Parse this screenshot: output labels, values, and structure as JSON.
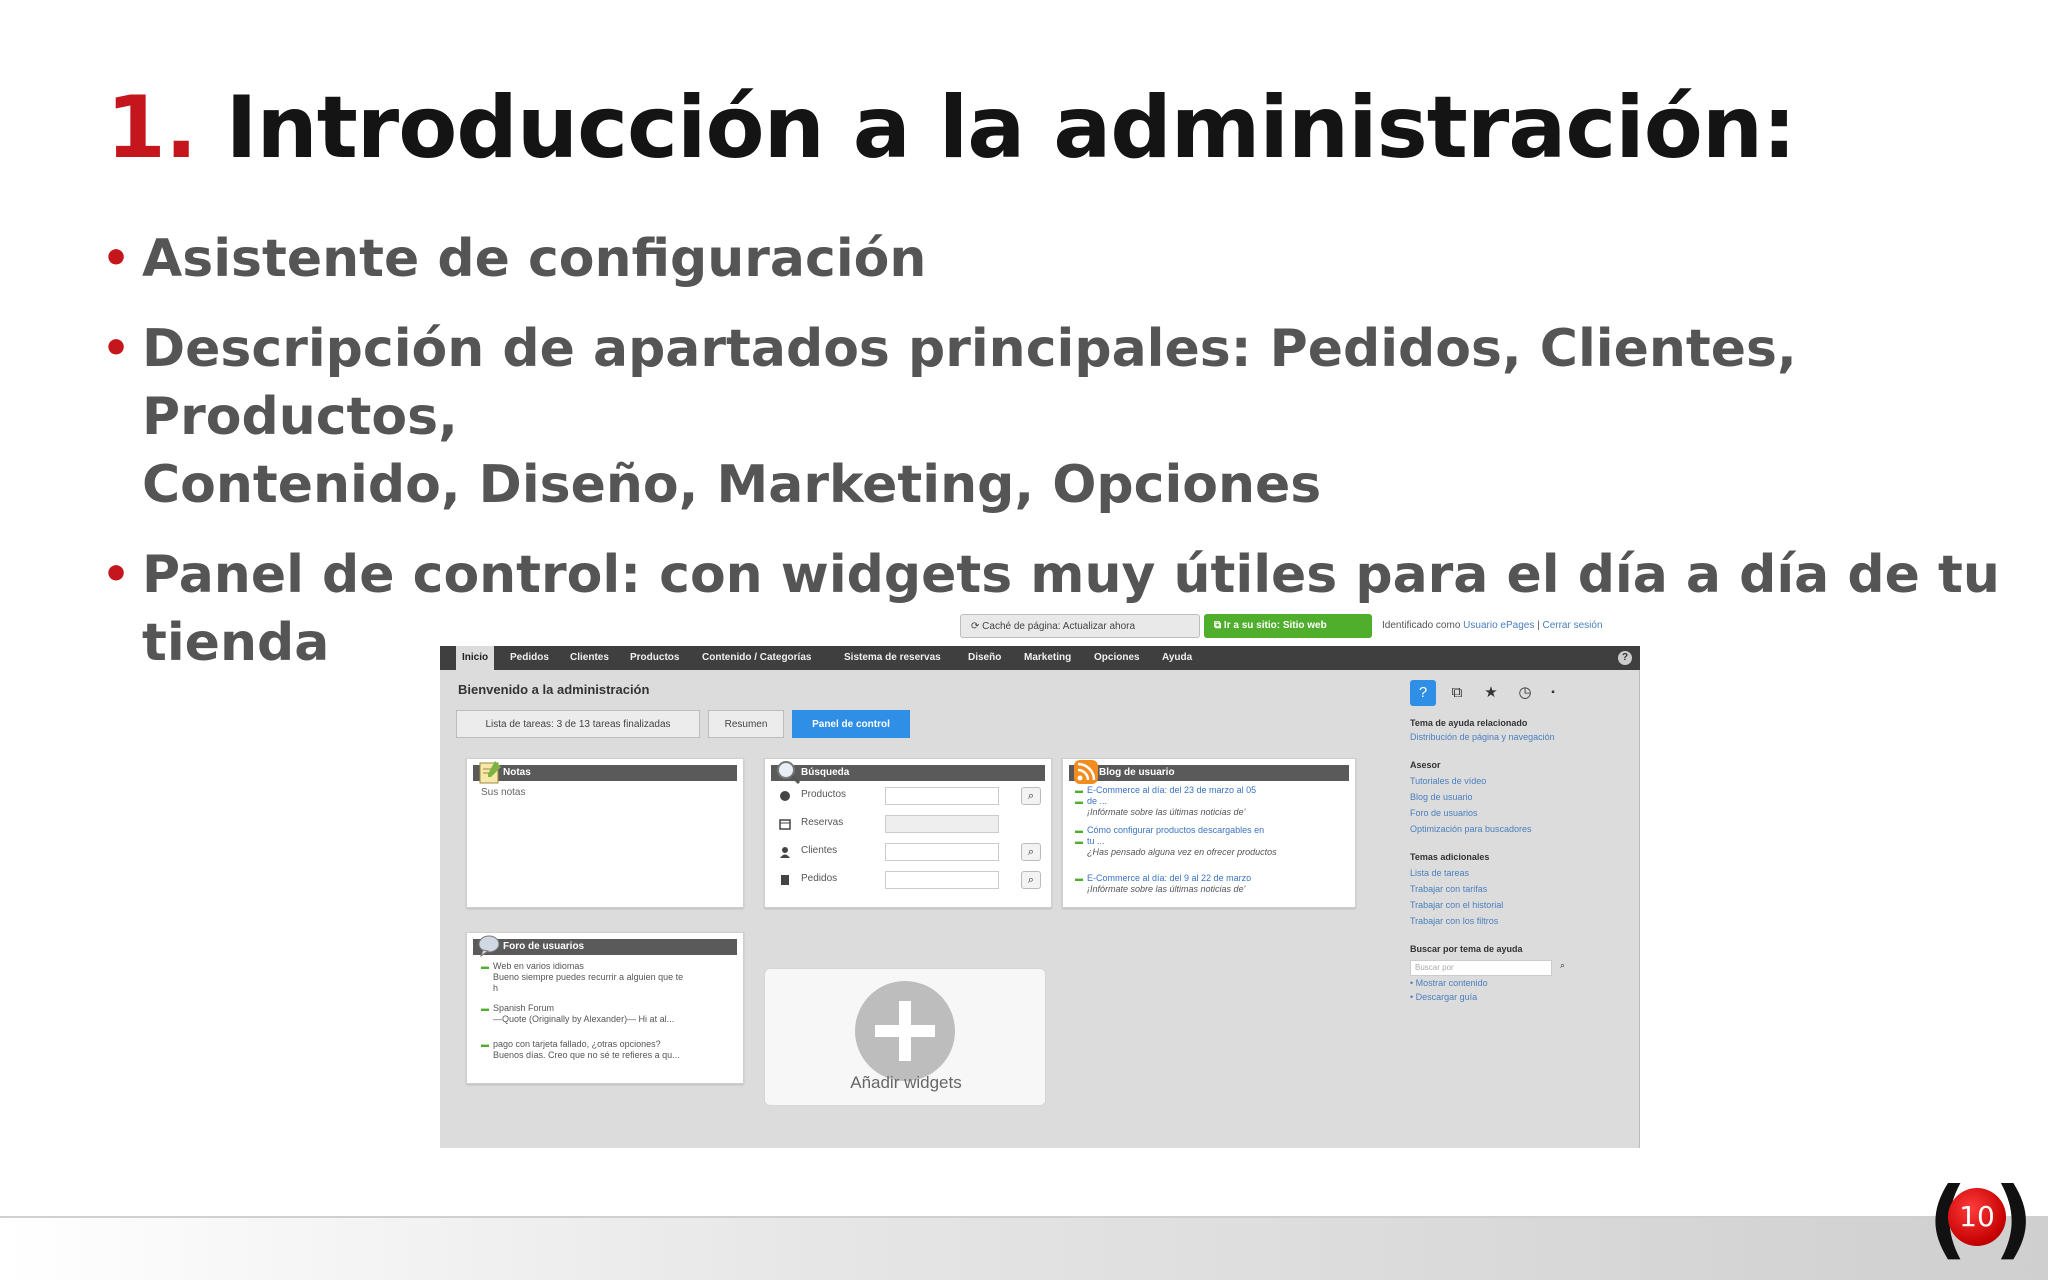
{
  "slide": {
    "number": "1.",
    "title": "Introducción a la administración:",
    "bullets": [
      {
        "line1": "Asistente de configuración",
        "line2": ""
      },
      {
        "line1": "Descripción de apartados principales: Pedidos, Clientes, Productos,",
        "line2": "Contenido, Diseño, Marketing, Opciones"
      },
      {
        "line1": "Panel de control: con widgets muy útiles para el día a día de tu",
        "line2": "tienda"
      }
    ],
    "page_number": "10",
    "accent_color": "#c4161c"
  },
  "admin": {
    "top": {
      "cache_label": "Caché de página: Actualizar ahora",
      "site_label": "Ir a su sitio: Sitio web",
      "ident_text": "Identificado como",
      "ident_user": "Usuario ePages",
      "logout": "Cerrar sesión"
    },
    "nav": [
      "Inicio",
      "Pedidos",
      "Clientes",
      "Productos",
      "Contenido / Categorías",
      "Sistema de reservas",
      "Diseño",
      "Marketing",
      "Opciones",
      "Ayuda"
    ],
    "welcome": "Bienvenido a la administración",
    "tabs": [
      "Lista de tareas: 3 de 13 tareas finalizadas",
      "Resumen",
      "Panel de control"
    ],
    "notes": {
      "title": "Notas",
      "body": "Sus notas"
    },
    "search": {
      "title": "Búsqueda",
      "rows": [
        "Productos",
        "Reservas",
        "Clientes",
        "Pedidos"
      ]
    },
    "blog": {
      "title": "Blog de usuario",
      "items": [
        {
          "title": "E-Commerce al día: del 23 de marzo al 05",
          "title2": "de ...",
          "desc": "¡Infórmate sobre las últimas noticias de'"
        },
        {
          "title": "Cómo configurar productos descargables en",
          "title2": "tu ...",
          "desc": "¿Has pensado alguna vez en ofrecer productos"
        },
        {
          "title": "E-Commerce al día: del 9 al 22 de marzo",
          "title2": "",
          "desc": "¡Infórmate sobre las últimas noticias de'"
        }
      ]
    },
    "forum": {
      "title": "Foro de usuarios",
      "items": [
        {
          "title": "Web en varios idiomas",
          "d1": "Bueno siempre puedes recurrir a alguien que te",
          "d2": "h"
        },
        {
          "title": "Spanish Forum",
          "d1": "—Quote (Originally by Alexander)— Hi at al...",
          "d2": ""
        },
        {
          "title": "pago con tarjeta fallado, ¿otras opciones?",
          "d1": "Buenos días. Creo que no sé te refieres a qu...",
          "d2": ""
        }
      ]
    },
    "add_widgets": "Añadir widgets",
    "sidebar": {
      "icons": [
        "help-icon",
        "copy-icon",
        "star-icon",
        "clock-icon"
      ],
      "related_title": "Tema de ayuda relacionado",
      "related_link": "Distribución de página y navegación",
      "asesor_title": "Asesor",
      "asesor_links": [
        "Tutoriales de vídeo",
        "Blog de usuario",
        "Foro de usuarios",
        "Optimización para buscadores"
      ],
      "extra_title": "Temas adicionales",
      "extra_links": [
        "Lista de tareas",
        "Trabajar con tarifas",
        "Trabajar con el historial",
        "Trabajar con los filtros"
      ],
      "search_title": "Buscar por tema de ayuda",
      "search_placeholder": "Buscar por",
      "search_links": [
        "• Mostrar contenido",
        "• Descargar guía"
      ]
    }
  }
}
